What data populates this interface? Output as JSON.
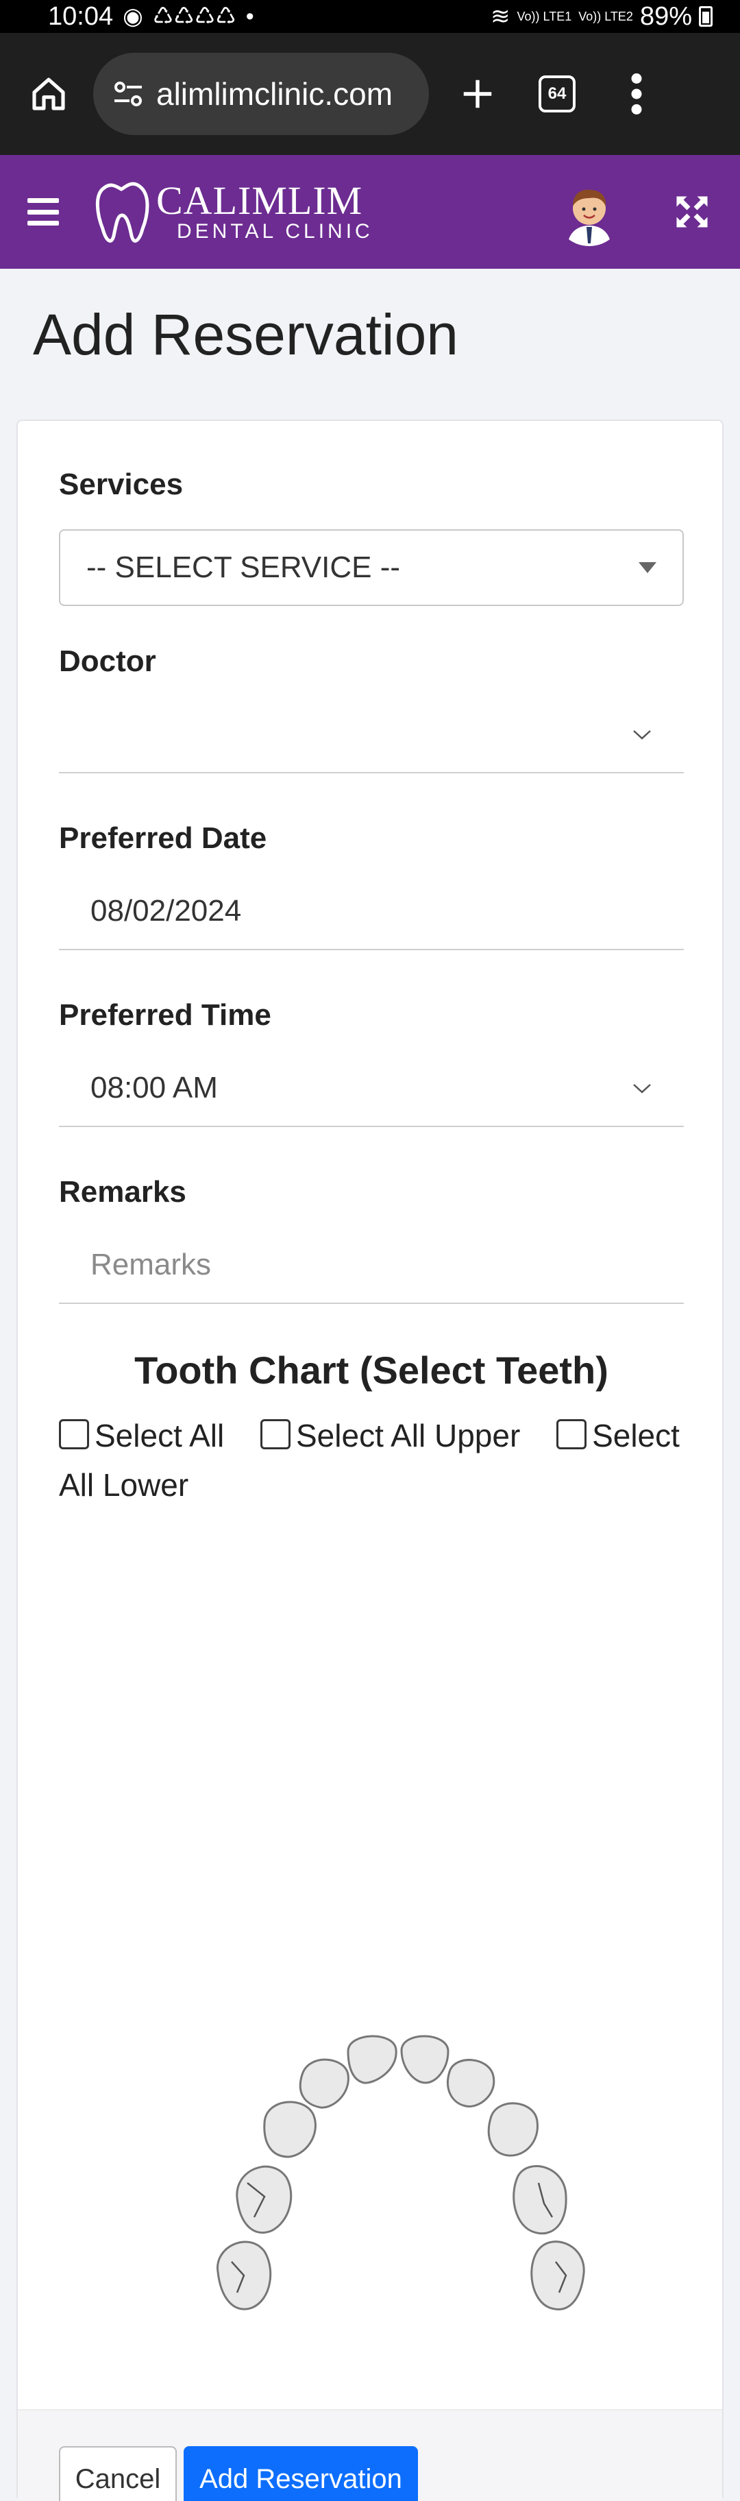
{
  "status_bar": {
    "time": "10:04",
    "signal1": "Vo)) LTE1",
    "signal2": "Vo)) LTE2",
    "battery": "89%"
  },
  "browser": {
    "url": "alimlimclinic.com",
    "tab_count": "64"
  },
  "app_header": {
    "logo_name": "CALIMLIM",
    "logo_sub": "DENTAL CLINIC"
  },
  "page": {
    "title": "Add Reservation"
  },
  "form": {
    "services_label": "Services",
    "services_value": "-- SELECT SERVICE --",
    "doctor_label": "Doctor",
    "doctor_value": "",
    "date_label": "Preferred Date",
    "date_value": "08/02/2024",
    "time_label": "Preferred Time",
    "time_value": "08:00 AM",
    "remarks_label": "Remarks",
    "remarks_placeholder": "Remarks"
  },
  "tooth_chart": {
    "title": "Tooth Chart (Select Teeth)",
    "select_all": "Select All",
    "select_upper": "Select All Upper",
    "select_lower": "Select All Lower"
  },
  "footer": {
    "cancel_label": "Cancel",
    "submit_label": "Add Reservation"
  },
  "colors": {
    "header_purple": "#6c2c91",
    "primary_blue": "#0d6efd"
  }
}
